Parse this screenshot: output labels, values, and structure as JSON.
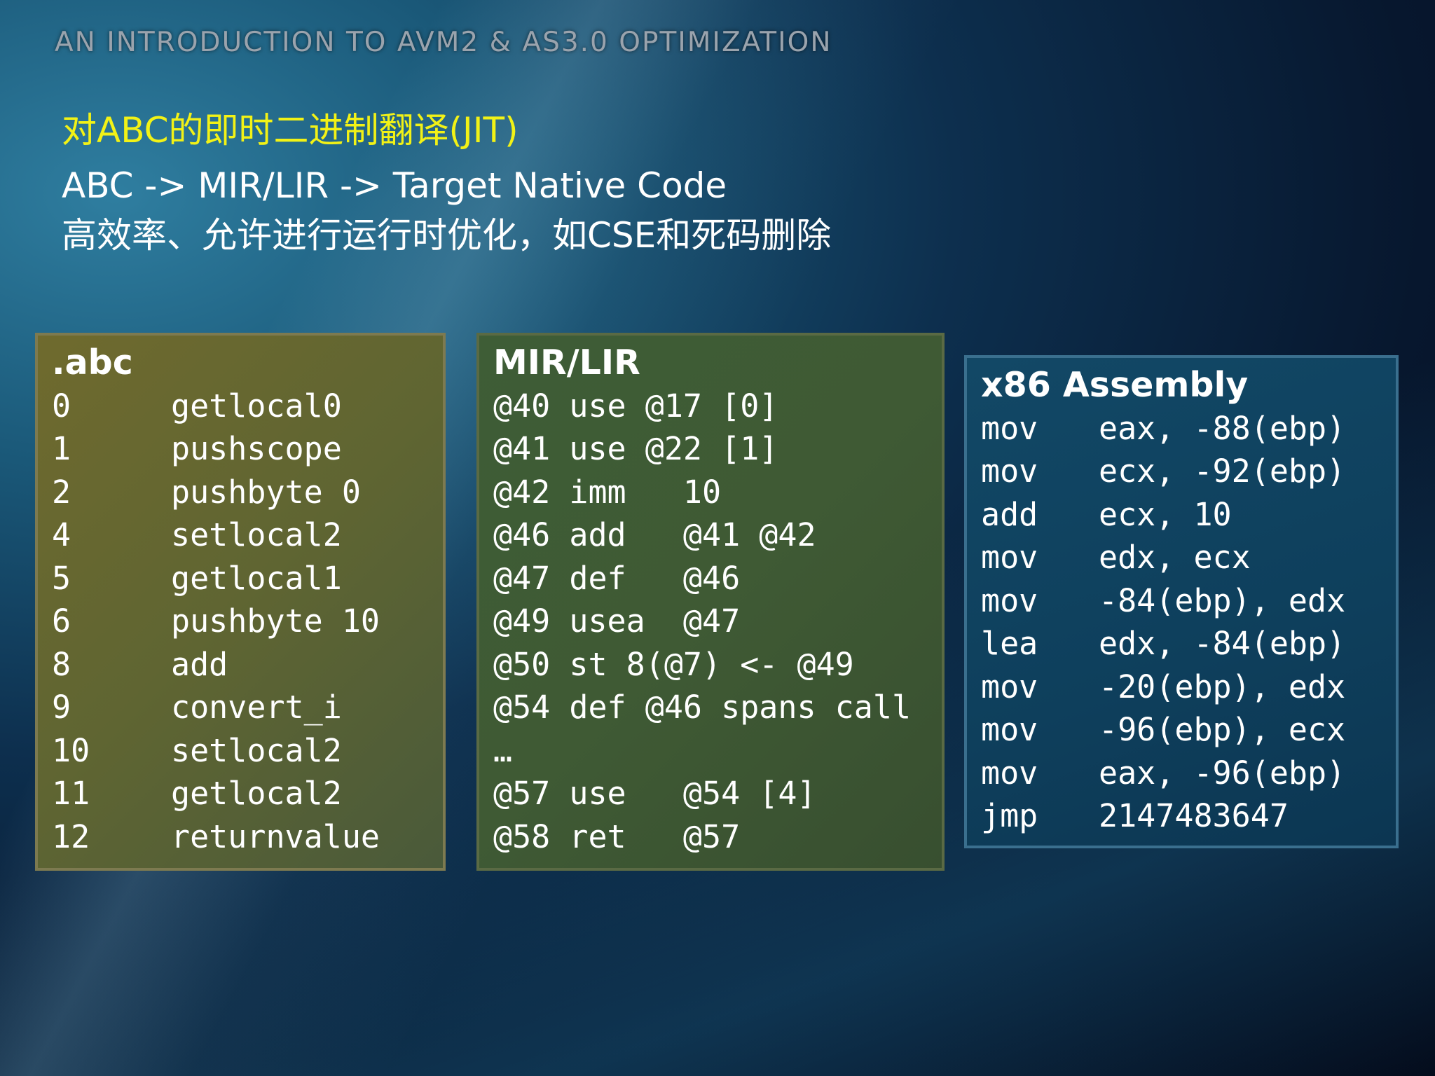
{
  "header": {
    "title": "AN INTRODUCTION TO AVM2 & AS3.0 OPTIMIZATION"
  },
  "content": {
    "heading": "对ABC的即时二进制翻译(JIT)",
    "line1": "ABC -> MIR/LIR -> Target Native Code",
    "line2": "高效率、允许进行运行时优化，如CSE和死码删除"
  },
  "abc_box": {
    "title": ".abc",
    "rows": [
      {
        "offset": "0",
        "op": "getlocal0"
      },
      {
        "offset": "1",
        "op": "pushscope"
      },
      {
        "offset": "2",
        "op": "pushbyte 0"
      },
      {
        "offset": "4",
        "op": "setlocal2"
      },
      {
        "offset": "5",
        "op": "getlocal1"
      },
      {
        "offset": "6",
        "op": "pushbyte 10"
      },
      {
        "offset": "8",
        "op": "add"
      },
      {
        "offset": "9",
        "op": "convert_i"
      },
      {
        "offset": "10",
        "op": "setlocal2"
      },
      {
        "offset": "11",
        "op": "getlocal2"
      },
      {
        "offset": "12",
        "op": "returnvalue"
      }
    ]
  },
  "mir_box": {
    "title": "MIR/LIR",
    "rows": [
      "@40 use @17 [0]",
      "@41 use @22 [1]",
      "@42 imm   10",
      "@46 add   @41 @42",
      "@47 def   @46",
      "@49 usea  @47",
      "@50 st 8(@7) <- @49",
      "@54 def @46 spans call",
      "…",
      "@57 use   @54 [4]",
      "@58 ret   @57"
    ]
  },
  "x86_box": {
    "title": "x86 Assembly",
    "rows": [
      {
        "op": "mov",
        "args": "eax, -88(ebp)"
      },
      {
        "op": "mov",
        "args": "ecx, -92(ebp)"
      },
      {
        "op": "add",
        "args": "ecx, 10"
      },
      {
        "op": "mov",
        "args": "edx, ecx"
      },
      {
        "op": "mov",
        "args": "-84(ebp), edx"
      },
      {
        "op": "lea",
        "args": "edx, -84(ebp)"
      },
      {
        "op": "mov",
        "args": "-20(ebp), edx"
      },
      {
        "op": "mov",
        "args": "-96(ebp), ecx"
      },
      {
        "op": "mov",
        "args": "eax, -96(ebp)"
      },
      {
        "op": "jmp",
        "args": "2147483647"
      }
    ]
  }
}
